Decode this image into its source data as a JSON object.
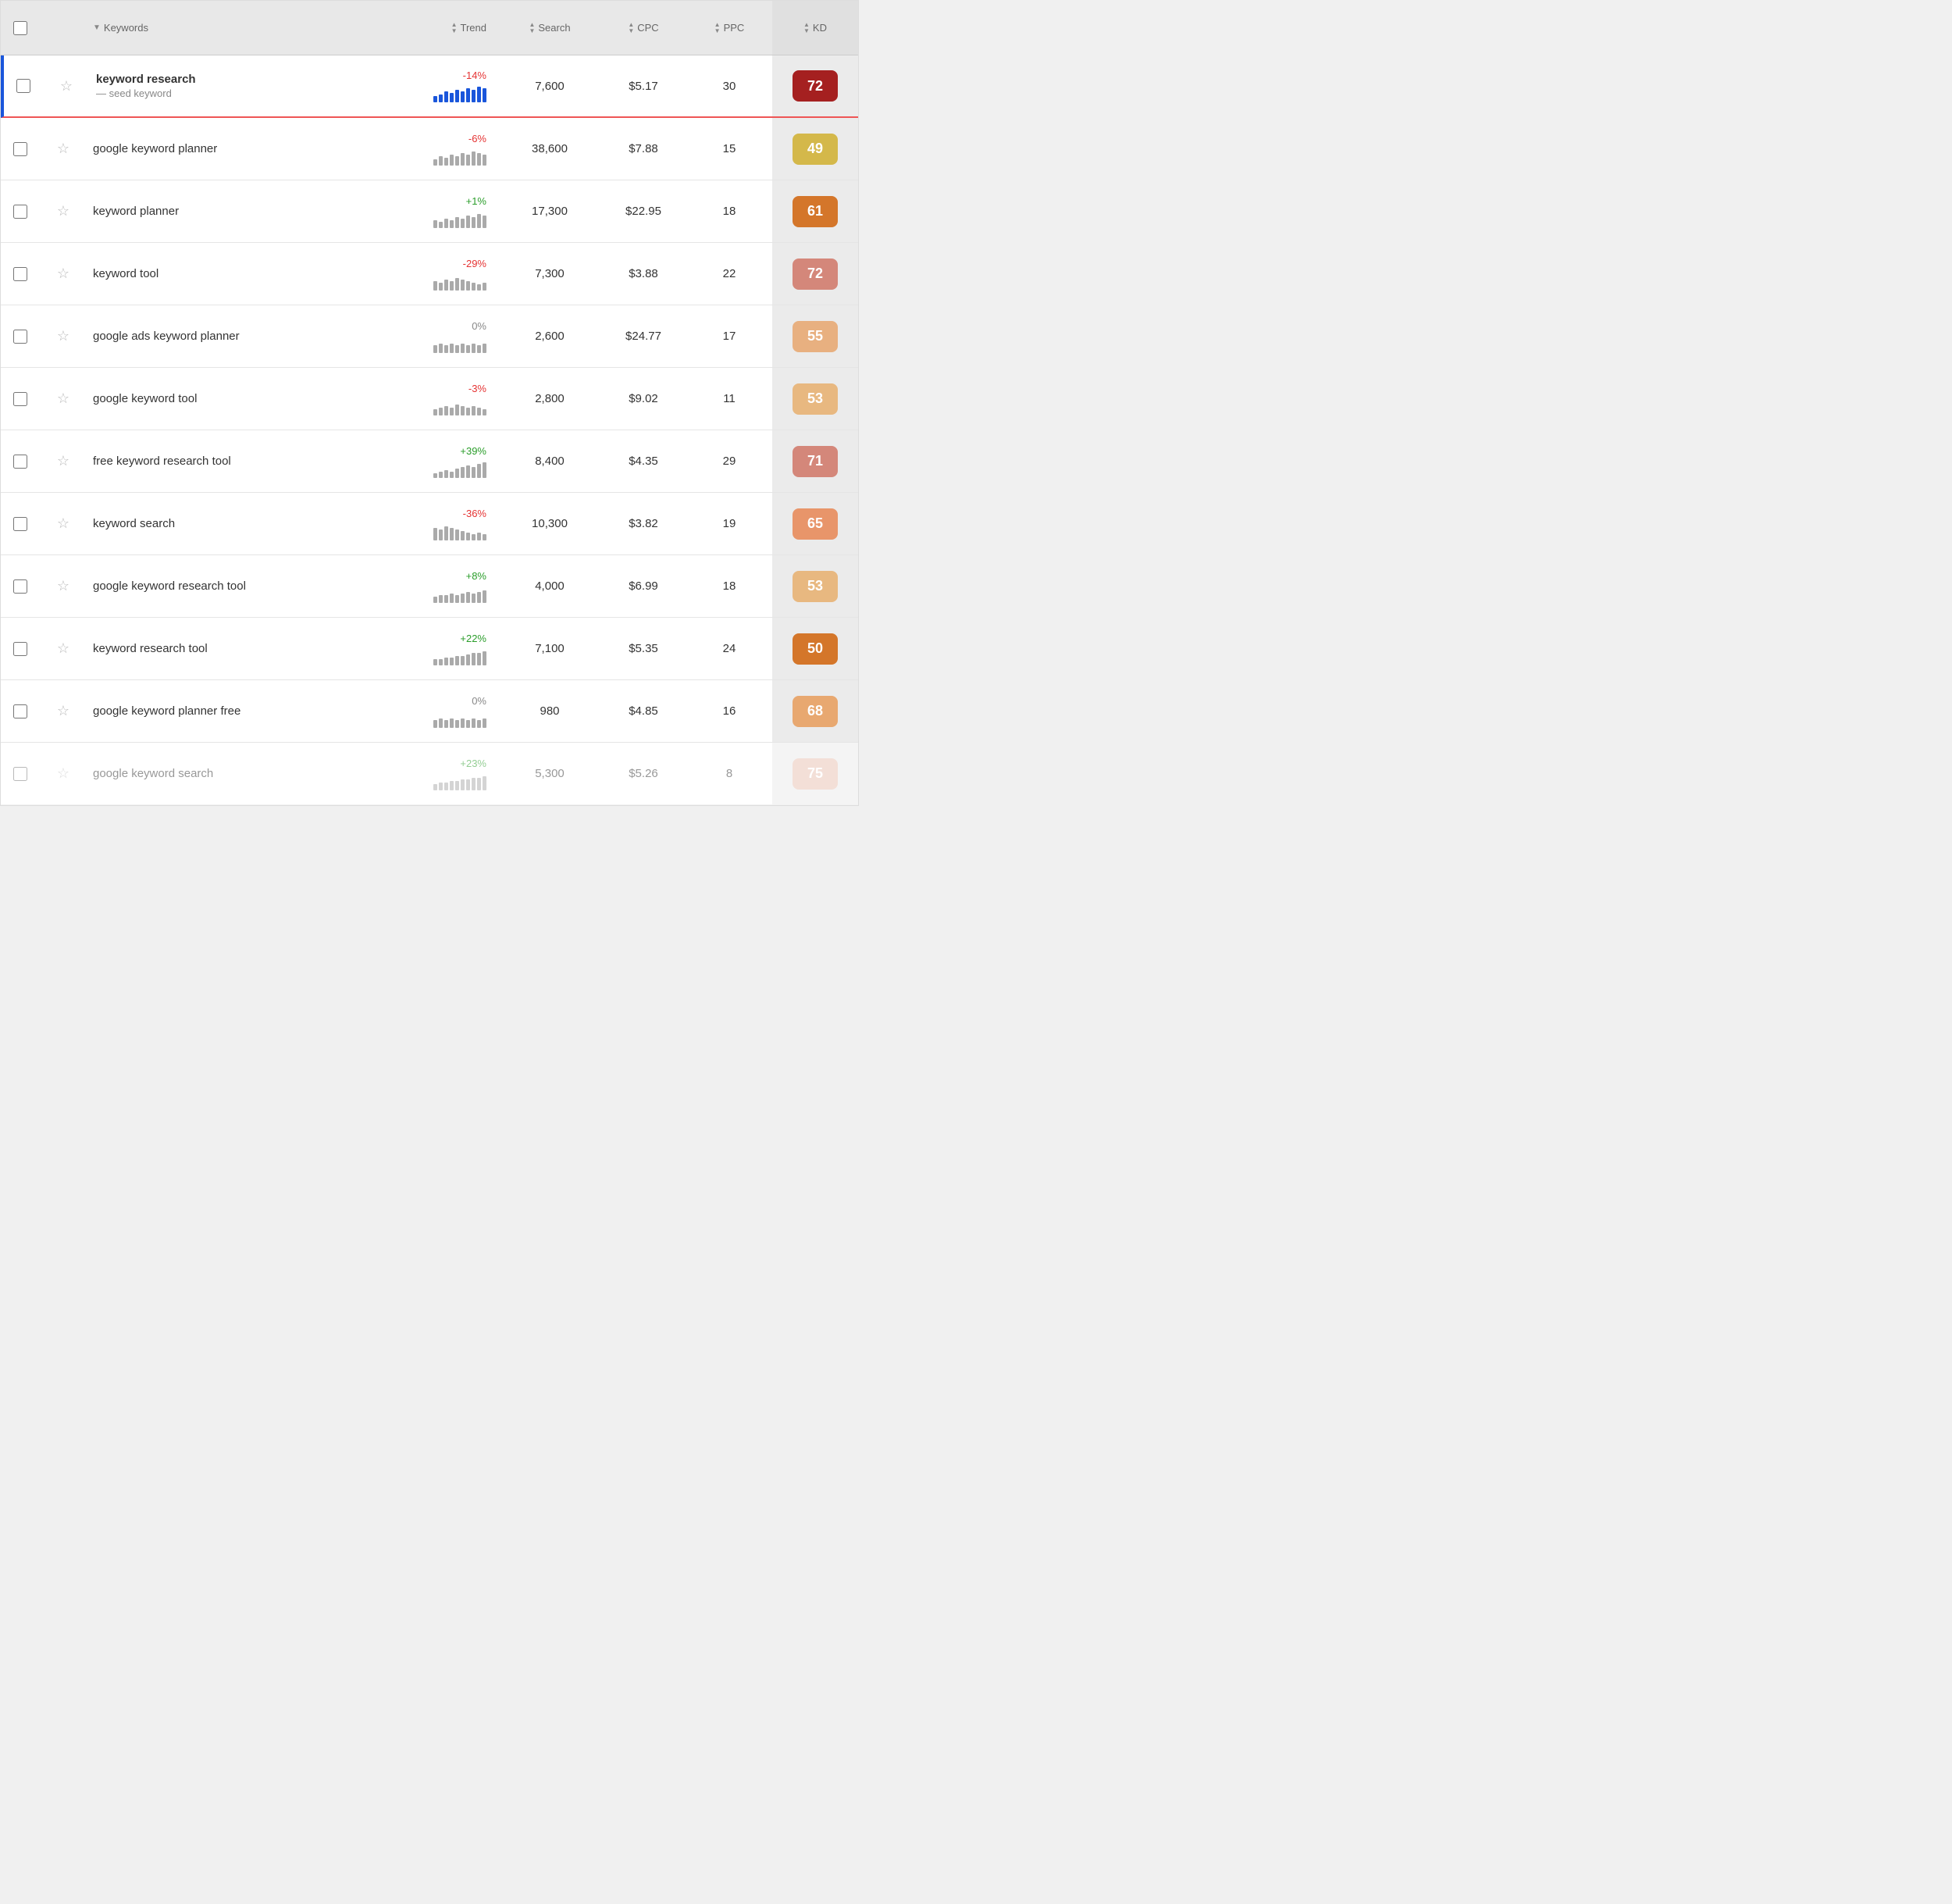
{
  "header": {
    "keywords_label": "Keywords",
    "trend_label": "Trend",
    "search_label": "Search",
    "cpc_label": "CPC",
    "ppc_label": "PPC",
    "kd_label": "KD"
  },
  "rows": [
    {
      "id": "keyword-research",
      "keyword": "keyword research",
      "is_seed": true,
      "seed_label": "— seed keyword",
      "trend_pct": "-14%",
      "trend_type": "negative",
      "search": "7,600",
      "cpc": "$5.17",
      "ppc": "30",
      "kd": "72",
      "kd_color": "#a52020",
      "bar_heights": [
        8,
        10,
        14,
        12,
        16,
        14,
        18,
        16,
        20,
        18
      ]
    },
    {
      "id": "google-keyword-planner",
      "keyword": "google keyword planner",
      "is_seed": false,
      "trend_pct": "-6%",
      "trend_type": "negative",
      "search": "38,600",
      "cpc": "$7.88",
      "ppc": "15",
      "kd": "49",
      "kd_color": "#d4b84a",
      "bar_heights": [
        8,
        12,
        10,
        14,
        12,
        16,
        14,
        18,
        16,
        14
      ]
    },
    {
      "id": "keyword-planner",
      "keyword": "keyword planner",
      "is_seed": false,
      "trend_pct": "+1%",
      "trend_type": "positive",
      "search": "17,300",
      "cpc": "$22.95",
      "ppc": "18",
      "kd": "61",
      "kd_color": "#d4762a",
      "bar_heights": [
        10,
        8,
        12,
        10,
        14,
        12,
        16,
        14,
        18,
        16
      ]
    },
    {
      "id": "keyword-tool",
      "keyword": "keyword tool",
      "is_seed": false,
      "trend_pct": "-29%",
      "trend_type": "negative",
      "search": "7,300",
      "cpc": "$3.88",
      "ppc": "22",
      "kd": "72",
      "kd_color": "#d4877a",
      "bar_heights": [
        12,
        10,
        14,
        12,
        16,
        14,
        12,
        10,
        8,
        10
      ]
    },
    {
      "id": "google-ads-keyword-planner",
      "keyword": "google ads keyword planner",
      "is_seed": false,
      "trend_pct": "0%",
      "trend_type": "neutral",
      "search": "2,600",
      "cpc": "$24.77",
      "ppc": "17",
      "kd": "55",
      "kd_color": "#e8b080",
      "bar_heights": [
        10,
        12,
        10,
        12,
        10,
        12,
        10,
        12,
        10,
        12
      ]
    },
    {
      "id": "google-keyword-tool",
      "keyword": "google keyword tool",
      "is_seed": false,
      "trend_pct": "-3%",
      "trend_type": "negative",
      "search": "2,800",
      "cpc": "$9.02",
      "ppc": "11",
      "kd": "53",
      "kd_color": "#e8b880",
      "bar_heights": [
        8,
        10,
        12,
        10,
        14,
        12,
        10,
        12,
        10,
        8
      ]
    },
    {
      "id": "free-keyword-research-tool",
      "keyword": "free keyword research tool",
      "is_seed": false,
      "trend_pct": "+39%",
      "trend_type": "positive",
      "search": "8,400",
      "cpc": "$4.35",
      "ppc": "29",
      "kd": "71",
      "kd_color": "#d4877a",
      "bar_heights": [
        6,
        8,
        10,
        8,
        12,
        14,
        16,
        14,
        18,
        20
      ]
    },
    {
      "id": "keyword-search",
      "keyword": "keyword search",
      "is_seed": false,
      "trend_pct": "-36%",
      "trend_type": "negative",
      "search": "10,300",
      "cpc": "$3.82",
      "ppc": "19",
      "kd": "65",
      "kd_color": "#e8956a",
      "bar_heights": [
        16,
        14,
        18,
        16,
        14,
        12,
        10,
        8,
        10,
        8
      ]
    },
    {
      "id": "google-keyword-research-tool",
      "keyword": "google keyword research tool",
      "is_seed": false,
      "trend_pct": "+8%",
      "trend_type": "positive",
      "search": "4,000",
      "cpc": "$6.99",
      "ppc": "18",
      "kd": "53",
      "kd_color": "#e8b880",
      "bar_heights": [
        8,
        10,
        10,
        12,
        10,
        12,
        14,
        12,
        14,
        16
      ]
    },
    {
      "id": "keyword-research-tool",
      "keyword": "keyword research tool",
      "is_seed": false,
      "trend_pct": "+22%",
      "trend_type": "positive",
      "search": "7,100",
      "cpc": "$5.35",
      "ppc": "24",
      "kd": "50",
      "kd_color": "#d4762a",
      "bar_heights": [
        8,
        8,
        10,
        10,
        12,
        12,
        14,
        16,
        16,
        18
      ]
    },
    {
      "id": "google-keyword-planner-free",
      "keyword": "google keyword planner free",
      "is_seed": false,
      "trend_pct": "0%",
      "trend_type": "neutral",
      "search": "980",
      "cpc": "$4.85",
      "ppc": "16",
      "kd": "68",
      "kd_color": "#e8a870",
      "bar_heights": [
        10,
        12,
        10,
        12,
        10,
        12,
        10,
        12,
        10,
        12
      ]
    },
    {
      "id": "google-keyword-search",
      "keyword": "google keyword search",
      "is_seed": false,
      "faded": true,
      "trend_pct": "+23%",
      "trend_type": "positive",
      "search": "5,300",
      "cpc": "$5.26",
      "ppc": "8",
      "kd": "75",
      "kd_color": "#e8c0b0",
      "bar_heights": [
        8,
        10,
        10,
        12,
        12,
        14,
        14,
        16,
        16,
        18
      ]
    }
  ]
}
